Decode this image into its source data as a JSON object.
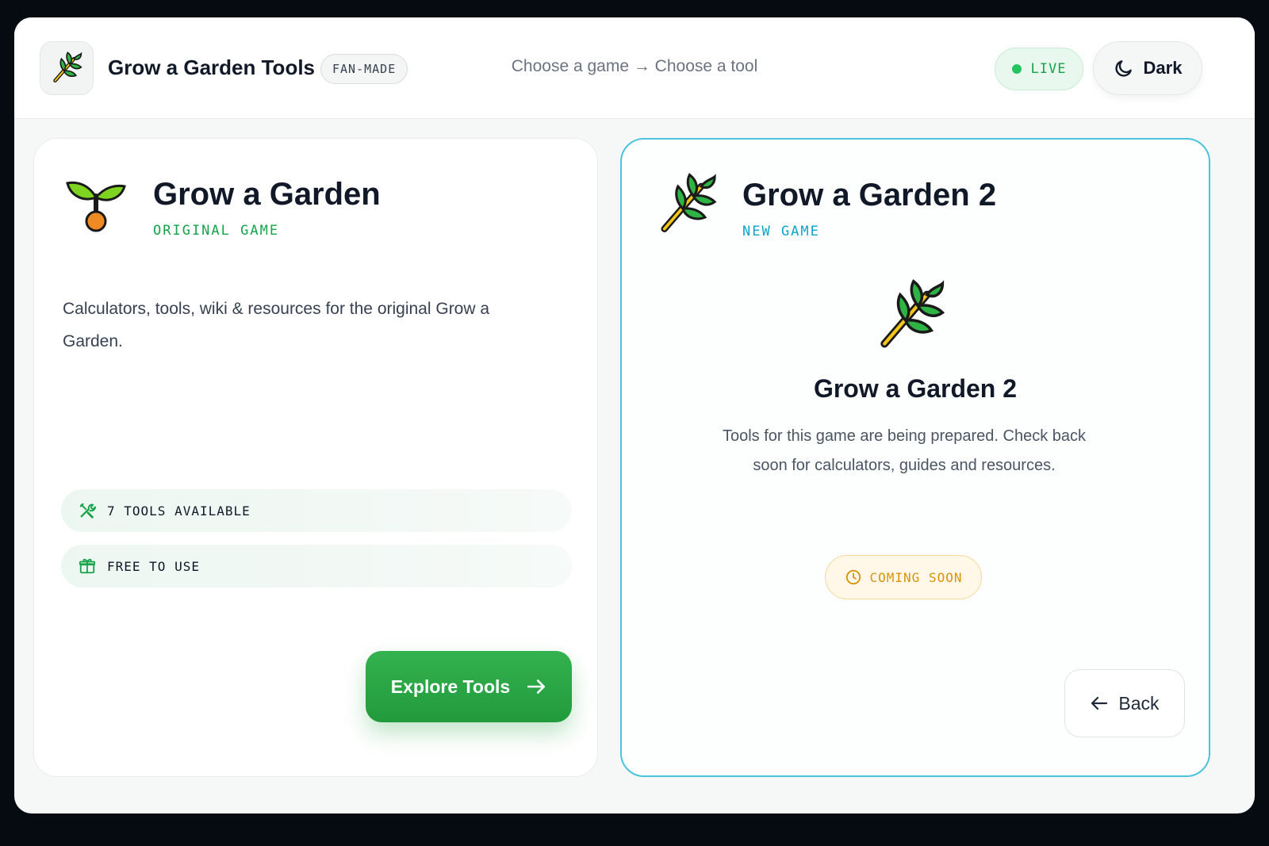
{
  "header": {
    "logo_icon": "herb-icon",
    "title": "Grow a Garden Tools",
    "badge": "FAN-MADE",
    "breadcrumb": "Choose a game → Choose a tool",
    "status": "LIVE",
    "theme_label": "Dark",
    "theme_icon": "moon-icon"
  },
  "games": [
    {
      "icon": "seedling-icon",
      "title": "Grow a Garden",
      "subtitle": "ORIGINAL GAME",
      "subtitle_color": "#16a34a",
      "description": "Calculators, tools, wiki & resources for the original Grow a Garden.",
      "features": [
        {
          "icon": "tools-icon",
          "label": "7 TOOLS AVAILABLE"
        },
        {
          "icon": "gift-icon",
          "label": "FREE TO USE"
        }
      ],
      "action_label": "Explore Tools",
      "action_icon": "arrow-right-icon"
    },
    {
      "icon": "herb-icon",
      "title": "Grow a Garden 2",
      "subtitle": "NEW GAME",
      "subtitle_color": "#0ea5c9",
      "center_title": "Grow a Garden 2",
      "center_description": "Tools for this game are being prepared. Check back soon for calculators, guides and resources.",
      "status": "COMING SOON",
      "status_icon": "clock-icon",
      "back_label": "Back",
      "back_icon": "arrow-left-icon"
    }
  ],
  "colors": {
    "accent_green": "#22a03e",
    "accent_cyan": "#4cc3dc",
    "warning": "#d99307"
  }
}
